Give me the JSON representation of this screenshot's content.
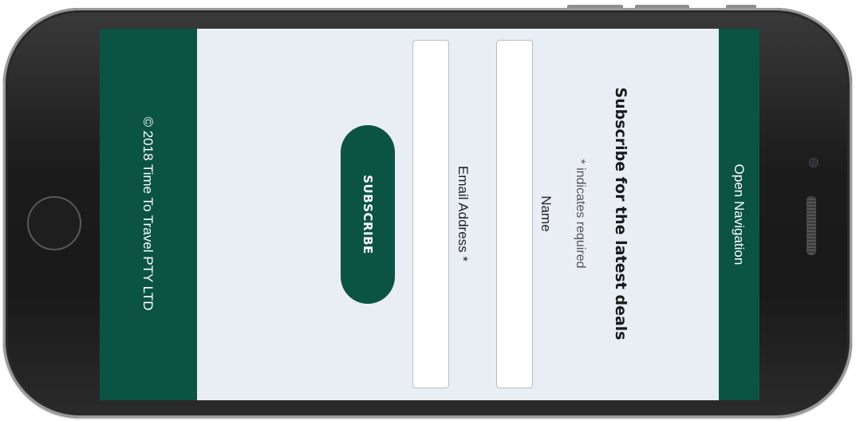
{
  "navigation": {
    "toggle_label": "Open Navigation"
  },
  "form": {
    "title": "Subscribe for the latest deals",
    "required_note": "* indicates required",
    "name_label": "Name",
    "email_label": "Email Address *",
    "submit_label": "SUBSCRIBE"
  },
  "footer": {
    "copyright": "© 2018 Time To Travel PTY LTD"
  },
  "colors": {
    "brand_green": "#0b5443",
    "screen_background": "#e9edf4"
  }
}
